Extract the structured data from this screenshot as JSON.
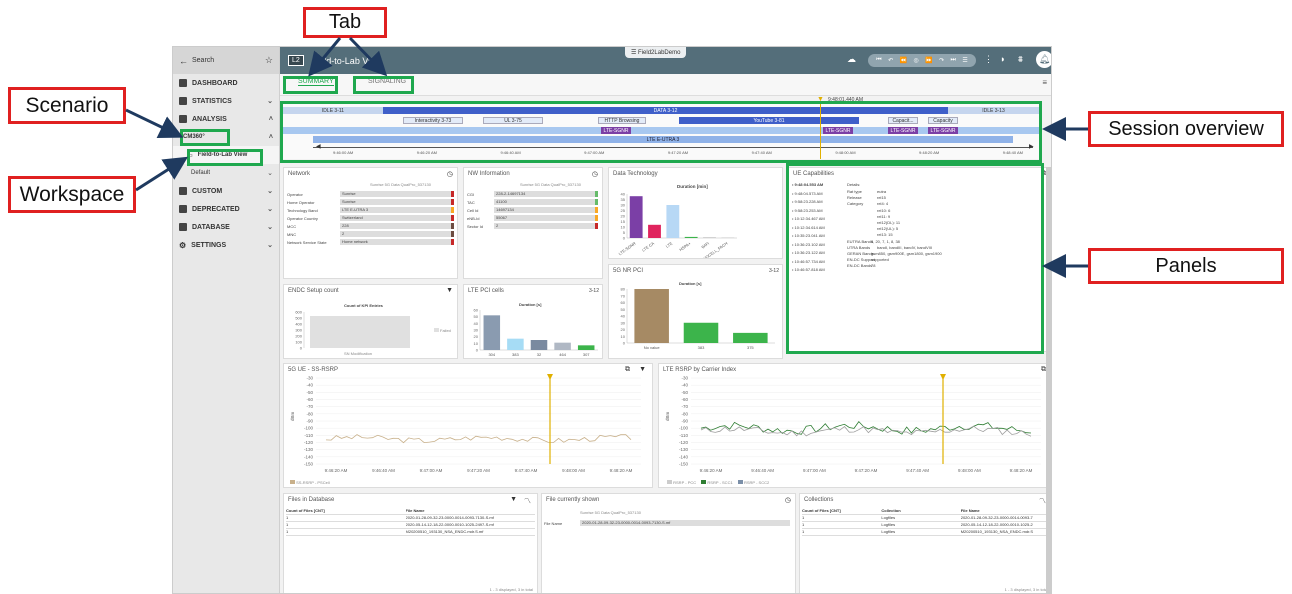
{
  "callouts": {
    "tab": "Tab",
    "scenario": "Scenario",
    "workspace": "Workspace",
    "session_overview": "Session overview",
    "panels": "Panels"
  },
  "colors": {
    "callout_border": "#e02020",
    "highlight": "#1fa84e",
    "topbar": "#546e7a",
    "arrow": "#1f3a5f"
  },
  "sidebar": {
    "search": "Search",
    "items": [
      "DASHBOARD",
      "STATISTICS",
      "ANALYSIS",
      "CM360°",
      "Field-to-Lab View",
      "Default",
      "CUSTOM",
      "DEPRECATED",
      "DATABASE",
      "SETTINGS"
    ]
  },
  "topbar": {
    "badge": "L2",
    "title": "Field-to-Lab View",
    "center": "Field2LabDemo"
  },
  "tabs": [
    "SUMMARY",
    "SIGNALING"
  ],
  "session": {
    "timestamp": "9:48:01.440 AM",
    "date": "1/28/2020",
    "segments": [
      "IDLE 3-11",
      "DATA 3-12",
      "IDLE 3-13",
      "Interactivity 3-73",
      "UL 3-75",
      "HTTP Browsing",
      "YouTube 3-81",
      "Capacit...",
      "Capacity",
      "LTE-SGNR",
      "LTE E-UTRA 3"
    ],
    "times": [
      "9:46:00 AM",
      "9:46:20 AM",
      "9:46:40 AM",
      "9:47:00 AM",
      "9:47:20 AM",
      "9:47:40 AM",
      "9:48:00 AM",
      "9:48:20 AM",
      "9:48:40 AM"
    ]
  },
  "network": {
    "title": "Network",
    "source": "Sunrise 5G Data QualPro_537130",
    "rows": [
      [
        "Operator",
        "Sunrise"
      ],
      [
        "Home Operator",
        "Sunrise"
      ],
      [
        "Technology Band",
        "LTE E-UTRA 3"
      ],
      [
        "Operator Country",
        "Switzerland"
      ],
      [
        "MCC",
        "228"
      ],
      [
        "MNC",
        "2"
      ],
      [
        "Network Service State",
        "Home network"
      ]
    ]
  },
  "nw_info": {
    "title": "NW Information",
    "source": "Sunrise 5G Data QualPro_537130",
    "rows": [
      [
        "CGI",
        "228-2-14697134"
      ],
      [
        "TAC",
        "41100"
      ],
      [
        "Cell Id",
        "14697134"
      ],
      [
        "eNB-Id",
        "55067"
      ],
      [
        "Sector Id",
        "2"
      ]
    ]
  },
  "data_tech": {
    "title": "Data Technology",
    "chart_title": "Duration [min]",
    "categories": [
      "LTE-SGNR",
      "LTE CA",
      "LTE",
      "HSPA+",
      "WIFI",
      "WINDCELL_FACH"
    ],
    "values": [
      38,
      12,
      30,
      1,
      0.3,
      0.2
    ],
    "yticks": [
      "40",
      "35",
      "30",
      "25",
      "20",
      "15",
      "10",
      "5",
      "0"
    ],
    "colors": [
      "#7b3fa6",
      "#e0245e",
      "#b7d8f5",
      "#3cb44b",
      "#888888",
      "#aaaaaa"
    ]
  },
  "ue_cap": {
    "title": "UE Capabilities",
    "times": [
      "9:48:04.553 AM",
      "9:48:04.573 AM",
      "9:58:23.228 AM",
      "9:58:23.253 AM",
      "10:12:34.467 AM",
      "10:12:34.614 AM",
      "10:35:23.041 AM",
      "10:36:23.102 AM",
      "10:36:23.122 AM",
      "10:46:57.734 AM",
      "10:46:57.818 AM"
    ],
    "details_label": "Details:",
    "details": [
      [
        "Rat type",
        "eutra"
      ],
      [
        "Release",
        "rel15"
      ],
      [
        "Category",
        "rel4: 4"
      ],
      [
        "",
        "rel10: 6"
      ],
      [
        "",
        "rel11: 9"
      ],
      [
        "",
        "rel12(DL): 11"
      ],
      [
        "",
        "rel12(UL): 5"
      ],
      [
        "",
        "rel13: 15"
      ],
      [
        "EUTRA Bands",
        "3, 20, 7, 1, 8, 38"
      ],
      [
        "UTRA Bands",
        "bandI, bandIII, bandV, bandVIII"
      ],
      [
        "GERAN Bands",
        "gsm850, gsm900E, gsm1800, gsm1900"
      ],
      [
        "EN-DC Support",
        "supported"
      ],
      [
        "EN-DC Bands",
        "78"
      ]
    ]
  },
  "endc": {
    "title": "ENDC Setup count",
    "chart_title": "Count of KPI Entries",
    "legend": "Failed",
    "xlabel": "SN Modification",
    "yticks": [
      "600",
      "500",
      "400",
      "300",
      "200",
      "100",
      "0"
    ]
  },
  "lte_pci": {
    "title": "LTE PCI cells",
    "badge": "3-12",
    "chart_title": "Duration [s]",
    "categories": [
      "304",
      "383",
      "32",
      "464",
      "307"
    ],
    "values": [
      52,
      17,
      15,
      11,
      7
    ],
    "colors": [
      "#8a9bb0",
      "#a6dcf5",
      "#7a8aa0",
      "#b0b8c4",
      "#3cb44b"
    ],
    "yticks": [
      "60",
      "50",
      "40",
      "30",
      "20",
      "10",
      "0"
    ]
  },
  "nr_pci": {
    "title": "5G NR PCI",
    "badge": "3-12",
    "chart_title": "Duration [s]",
    "categories": [
      "No value",
      "383",
      "375"
    ],
    "values": [
      80,
      30,
      15
    ],
    "colors": [
      "#a68a64",
      "#3cb44b",
      "#3cb44b"
    ],
    "yticks": [
      "80",
      "70",
      "60",
      "50",
      "40",
      "30",
      "20",
      "10",
      "0"
    ]
  },
  "nr_rsrp": {
    "title": "5G UE - SS-RSRP",
    "legend": "SS-RSRP - PSCell",
    "ylabel": "dBm",
    "yticks": [
      "-30",
      "-40",
      "-50",
      "-60",
      "-70",
      "-80",
      "-90",
      "-100",
      "-110",
      "-120",
      "-130",
      "-140",
      "-150"
    ],
    "xticks": [
      "9:46:20 AM",
      "9:46:40 AM",
      "9:47:00 AM",
      "9:47:20 AM",
      "9:47:40 AM",
      "9:48:00 AM",
      "9:48:20 AM"
    ]
  },
  "lte_rsrp": {
    "title": "LTE RSRP by Carrier Index",
    "legend": [
      "RSRP - PCC",
      "RSRP - SCC1",
      "RSRP - SCC2"
    ],
    "ylabel": "dBm",
    "yticks": [
      "-30",
      "-40",
      "-50",
      "-60",
      "-70",
      "-80",
      "-90",
      "-100",
      "-110",
      "-120",
      "-130",
      "-140",
      "-150"
    ],
    "xticks": [
      "9:46:20 AM",
      "9:46:40 AM",
      "9:47:00 AM",
      "9:47:20 AM",
      "9:47:40 AM",
      "9:48:00 AM",
      "9:48:20 AM"
    ]
  },
  "files_db": {
    "title": "Files in Database",
    "headers": [
      "Count of Files [CNT]",
      "File Name"
    ],
    "rows": [
      [
        "1",
        "2020-01-28-09-32-23-0000-0014-0093-7130-S.mf"
      ],
      [
        "1",
        "2020-05-14-12-18-22-0000-0010-1025-2497-S.mf"
      ],
      [
        "1",
        "M20200510_193130_NSA_ENDC.mdr.S.mf"
      ]
    ],
    "footer": "1 - 3 displayed, 3 in total"
  },
  "file_shown": {
    "title": "File currently shown",
    "source": "Sunrise 5G Data QualPro_537130",
    "label": "File Name",
    "value": "2020-01-28-09-32-23-0000-0014-0093-7130-S.mf"
  },
  "collections": {
    "title": "Collections",
    "headers": [
      "Count of Files [CNT]",
      "Collection",
      "File Name"
    ],
    "rows": [
      [
        "1",
        "Logfiles",
        "2020-01-28-09-32-23-0000-0014-0093-7"
      ],
      [
        "1",
        "Logfiles",
        "2020-05-14-12-18-22-0000-0010-1025-2"
      ],
      [
        "1",
        "Logfiles",
        "M20200510_193130_NSA_ENDC.mdr.S"
      ]
    ],
    "footer": "1 - 3 displayed, 3 in total"
  }
}
